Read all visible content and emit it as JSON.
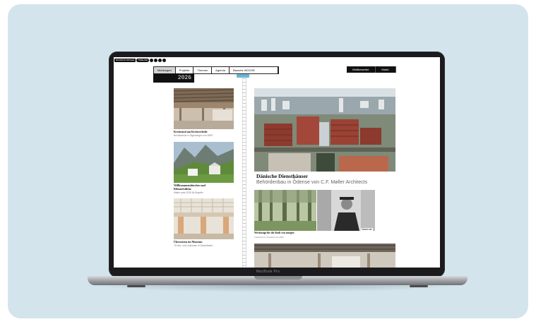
{
  "device": {
    "model_label": "MacBook Pro"
  },
  "site": {
    "logo": {
      "text": "BAUNETZ WOCHE",
      "pill": "TIMELINE"
    },
    "nav": [
      "Meldungen",
      "Projekte",
      "Themen",
      "Agenda",
      "Baunetz WOCHE"
    ],
    "nav_right": [
      "Wettbewerbe",
      "Markt"
    ],
    "year": "2026"
  },
  "left_articles": [
    {
      "title": "Kreisrund am Kreisverkehr",
      "subtitle": "Berufsschule in Sigmaringen von SIRO"
    },
    {
      "title": "Willkommensbüscher und Klimaresilienz",
      "subtitle": "Walter preis 2026 für Brigellio"
    },
    {
      "title": "Übersetzen im Museum",
      "subtitle": "75 Neu- und Umbauten in Deutschland"
    }
  ],
  "feature": {
    "title": "Dänische Dienstḥäuser",
    "subtitle": "Behördenbau in Odense von C.F. Møller Architects"
  },
  "small_article": {
    "title": "Werkzeuge für die Stadt von morgen",
    "subtitle": "Freiraume in Frankfurt am Main"
  },
  "nachrufe_label": "Nachrufe",
  "colors": {
    "card_bg": "#d3e4ec",
    "timeline_tag": "#6db6d6",
    "nav_active": "#d4d4d4"
  }
}
